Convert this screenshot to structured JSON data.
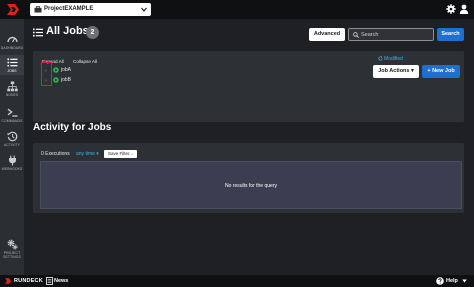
{
  "project": {
    "name": "ProjectEXAMPLE"
  },
  "sidenav": {
    "items": [
      {
        "label": "DASHBOARD",
        "icon": "dashboard-icon"
      },
      {
        "label": "JOBS",
        "icon": "list-icon"
      },
      {
        "label": "NODES",
        "icon": "sitemap-icon"
      },
      {
        "label": "COMMANDS",
        "icon": "terminal-icon"
      },
      {
        "label": "ACTIVITY",
        "icon": "history-icon"
      },
      {
        "label": "WEBHOOKS",
        "icon": "plug-icon"
      },
      {
        "label": "PROJECT SETTINGS",
        "icon": "gears-icon"
      }
    ]
  },
  "header": {
    "title": "All Jobs",
    "count": "2",
    "advanced_label": "Advanced",
    "search_placeholder": "Search",
    "search_button": "Search"
  },
  "jobs_panel": {
    "expand_all": "Expand All",
    "collapse_all": "Collapse All",
    "modified_label": "Modified",
    "job_actions_label": "Job Actions",
    "new_job_label": "New Job",
    "jobs": [
      {
        "name": "jobA"
      },
      {
        "name": "jobB"
      }
    ]
  },
  "activity": {
    "title": "Activity for Jobs",
    "exec_count": "0 Executions",
    "time_filter": "any time",
    "save_filters_label": "Save Filter...",
    "empty_message": "No results for the query"
  },
  "footer": {
    "brand": "RUNDECK",
    "news_label": "News",
    "help_label": "Help"
  },
  "colors": {
    "accent_blue": "#1f6fd1",
    "link_cyan": "#30b8e6",
    "run_green": "#2fb34a",
    "highlight_red": "#e02020",
    "brand_red": "#e0211c"
  }
}
